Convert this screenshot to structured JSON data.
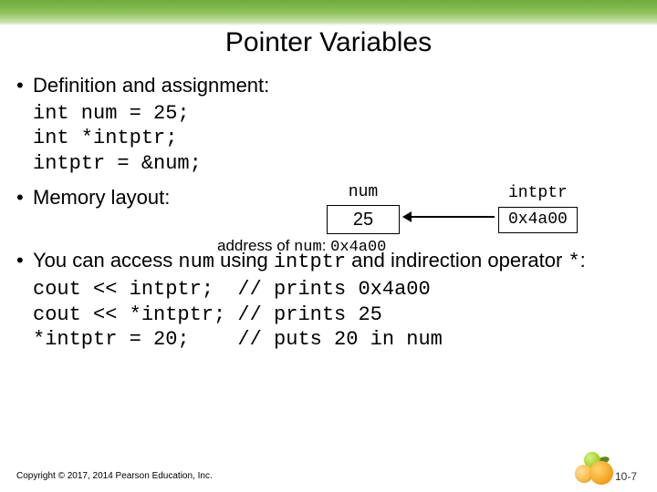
{
  "title": "Pointer Variables",
  "bullets": {
    "b1_text": "Definition and assignment:",
    "b1_code": "int num = 25;\nint *intptr;\nintptr = &num;",
    "b2_text": "Memory layout:",
    "b3_pre": "You can access ",
    "b3_var1": "num",
    "b3_mid": " using ",
    "b3_var2": "intptr",
    "b3_post1": " and indirection operator ",
    "b3_op": "*",
    "b3_post2": ":",
    "b3_code": "cout << intptr;  // prints 0x4a00\ncout << *intptr; // prints 25\n*intptr = 20;    // puts 20 in num"
  },
  "memory": {
    "num_label": "num",
    "num_value": "25",
    "ptr_label": "intptr",
    "ptr_value": "0x4a00",
    "caption_pre": "address of ",
    "caption_var": "num",
    "caption_mid": ": ",
    "caption_val": "0x4a00"
  },
  "footer": "Copyright © 2017, 2014 Pearson Education, Inc.",
  "slide_number": "10-7"
}
